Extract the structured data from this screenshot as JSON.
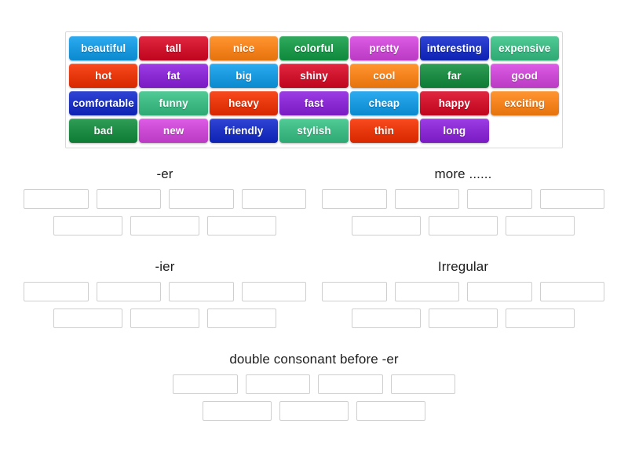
{
  "word_bank": {
    "name": "word-bank",
    "rows": [
      [
        {
          "label": "beautiful",
          "color": "#1b9ae0"
        },
        {
          "label": "tall",
          "color": "#d0162f"
        },
        {
          "label": "nice",
          "color": "#f5841f"
        },
        {
          "label": "colorful",
          "color": "#1f9a4d"
        },
        {
          "label": "pretty",
          "color": "#cc4bd4"
        },
        {
          "label": "interesting",
          "color": "#1e33c4"
        },
        {
          "label": "expensive",
          "color": "#3fba85"
        }
      ],
      [
        {
          "label": "hot",
          "color": "#e8380d"
        },
        {
          "label": "fat",
          "color": "#8b2bd4"
        },
        {
          "label": "big",
          "color": "#1b9ae0"
        },
        {
          "label": "shiny",
          "color": "#d0162f"
        },
        {
          "label": "cool",
          "color": "#f5841f"
        },
        {
          "label": "far",
          "color": "#1f8c46"
        },
        {
          "label": "good",
          "color": "#cc4bd4"
        }
      ],
      [
        {
          "label": "comfortable",
          "color": "#1e33c4"
        },
        {
          "label": "funny",
          "color": "#3fba85"
        },
        {
          "label": "heavy",
          "color": "#e8380d"
        },
        {
          "label": "fast",
          "color": "#8b2bd4"
        },
        {
          "label": "cheap",
          "color": "#1b9ae0"
        },
        {
          "label": "happy",
          "color": "#d0162f"
        },
        {
          "label": "exciting",
          "color": "#f5841f"
        }
      ],
      [
        {
          "label": "bad",
          "color": "#1f8c46"
        },
        {
          "label": "new",
          "color": "#cc4bd4"
        },
        {
          "label": "friendly",
          "color": "#1e33c4"
        },
        {
          "label": "stylish",
          "color": "#3fba85"
        },
        {
          "label": "thin",
          "color": "#e8380d"
        },
        {
          "label": "long",
          "color": "#8b2bd4"
        },
        {
          "label": "",
          "color": "",
          "empty": true
        }
      ]
    ]
  },
  "groups": [
    {
      "id": "er",
      "title": "-er",
      "rows": [
        4,
        3
      ],
      "slot_values": [
        [
          "",
          "",
          "",
          ""
        ],
        [
          "",
          "",
          ""
        ]
      ]
    },
    {
      "id": "more",
      "title": "more ......",
      "rows": [
        4,
        3
      ],
      "slot_values": [
        [
          "",
          "",
          "",
          ""
        ],
        [
          "",
          "",
          ""
        ]
      ]
    },
    {
      "id": "ier",
      "title": "-ier",
      "rows": [
        4,
        3
      ],
      "slot_values": [
        [
          "",
          "",
          "",
          ""
        ],
        [
          "",
          "",
          ""
        ]
      ]
    },
    {
      "id": "irreg",
      "title": "Irregular",
      "rows": [
        4,
        3
      ],
      "slot_values": [
        [
          "",
          "",
          "",
          ""
        ],
        [
          "",
          "",
          ""
        ]
      ]
    },
    {
      "id": "double",
      "title": "double consonant before -er",
      "rows": [
        4,
        3
      ],
      "slot_values": [
        [
          "",
          "",
          "",
          ""
        ],
        [
          "",
          "",
          ""
        ]
      ]
    }
  ],
  "theme": {
    "page_background": "#ffffff",
    "bank_border": "#d9d9d9",
    "slot_border": "#cfcfcf",
    "title_color": "#1d1d1d",
    "tile_text_color": "#ffffff"
  }
}
